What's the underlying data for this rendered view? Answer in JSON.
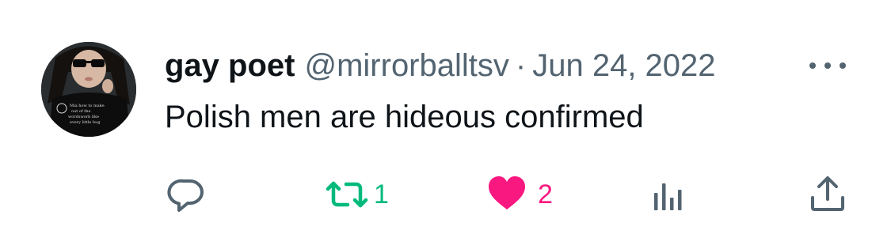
{
  "tweet": {
    "display_name": "gay poet",
    "handle": "@mirrorballtsv",
    "separator": "·",
    "date": "Jun 24, 2022",
    "text": "Polish men are hideous confirmed",
    "avatar_shirt_text": [
      "Mia how to make",
      "out of the",
      "wordswork like",
      "every little bug"
    ]
  },
  "actions": {
    "reply": {
      "icon": "reply-icon",
      "count": ""
    },
    "retweet": {
      "icon": "retweet-icon",
      "count": "1",
      "color": "#00ba7c"
    },
    "like": {
      "icon": "heart-icon",
      "count": "2",
      "color": "#f91880",
      "liked": true
    },
    "views": {
      "icon": "views-icon",
      "count": ""
    },
    "share": {
      "icon": "share-icon"
    }
  },
  "colors": {
    "text_primary": "#0f1419",
    "text_secondary": "#536471",
    "retweet": "#00ba7c",
    "like": "#f91880"
  }
}
